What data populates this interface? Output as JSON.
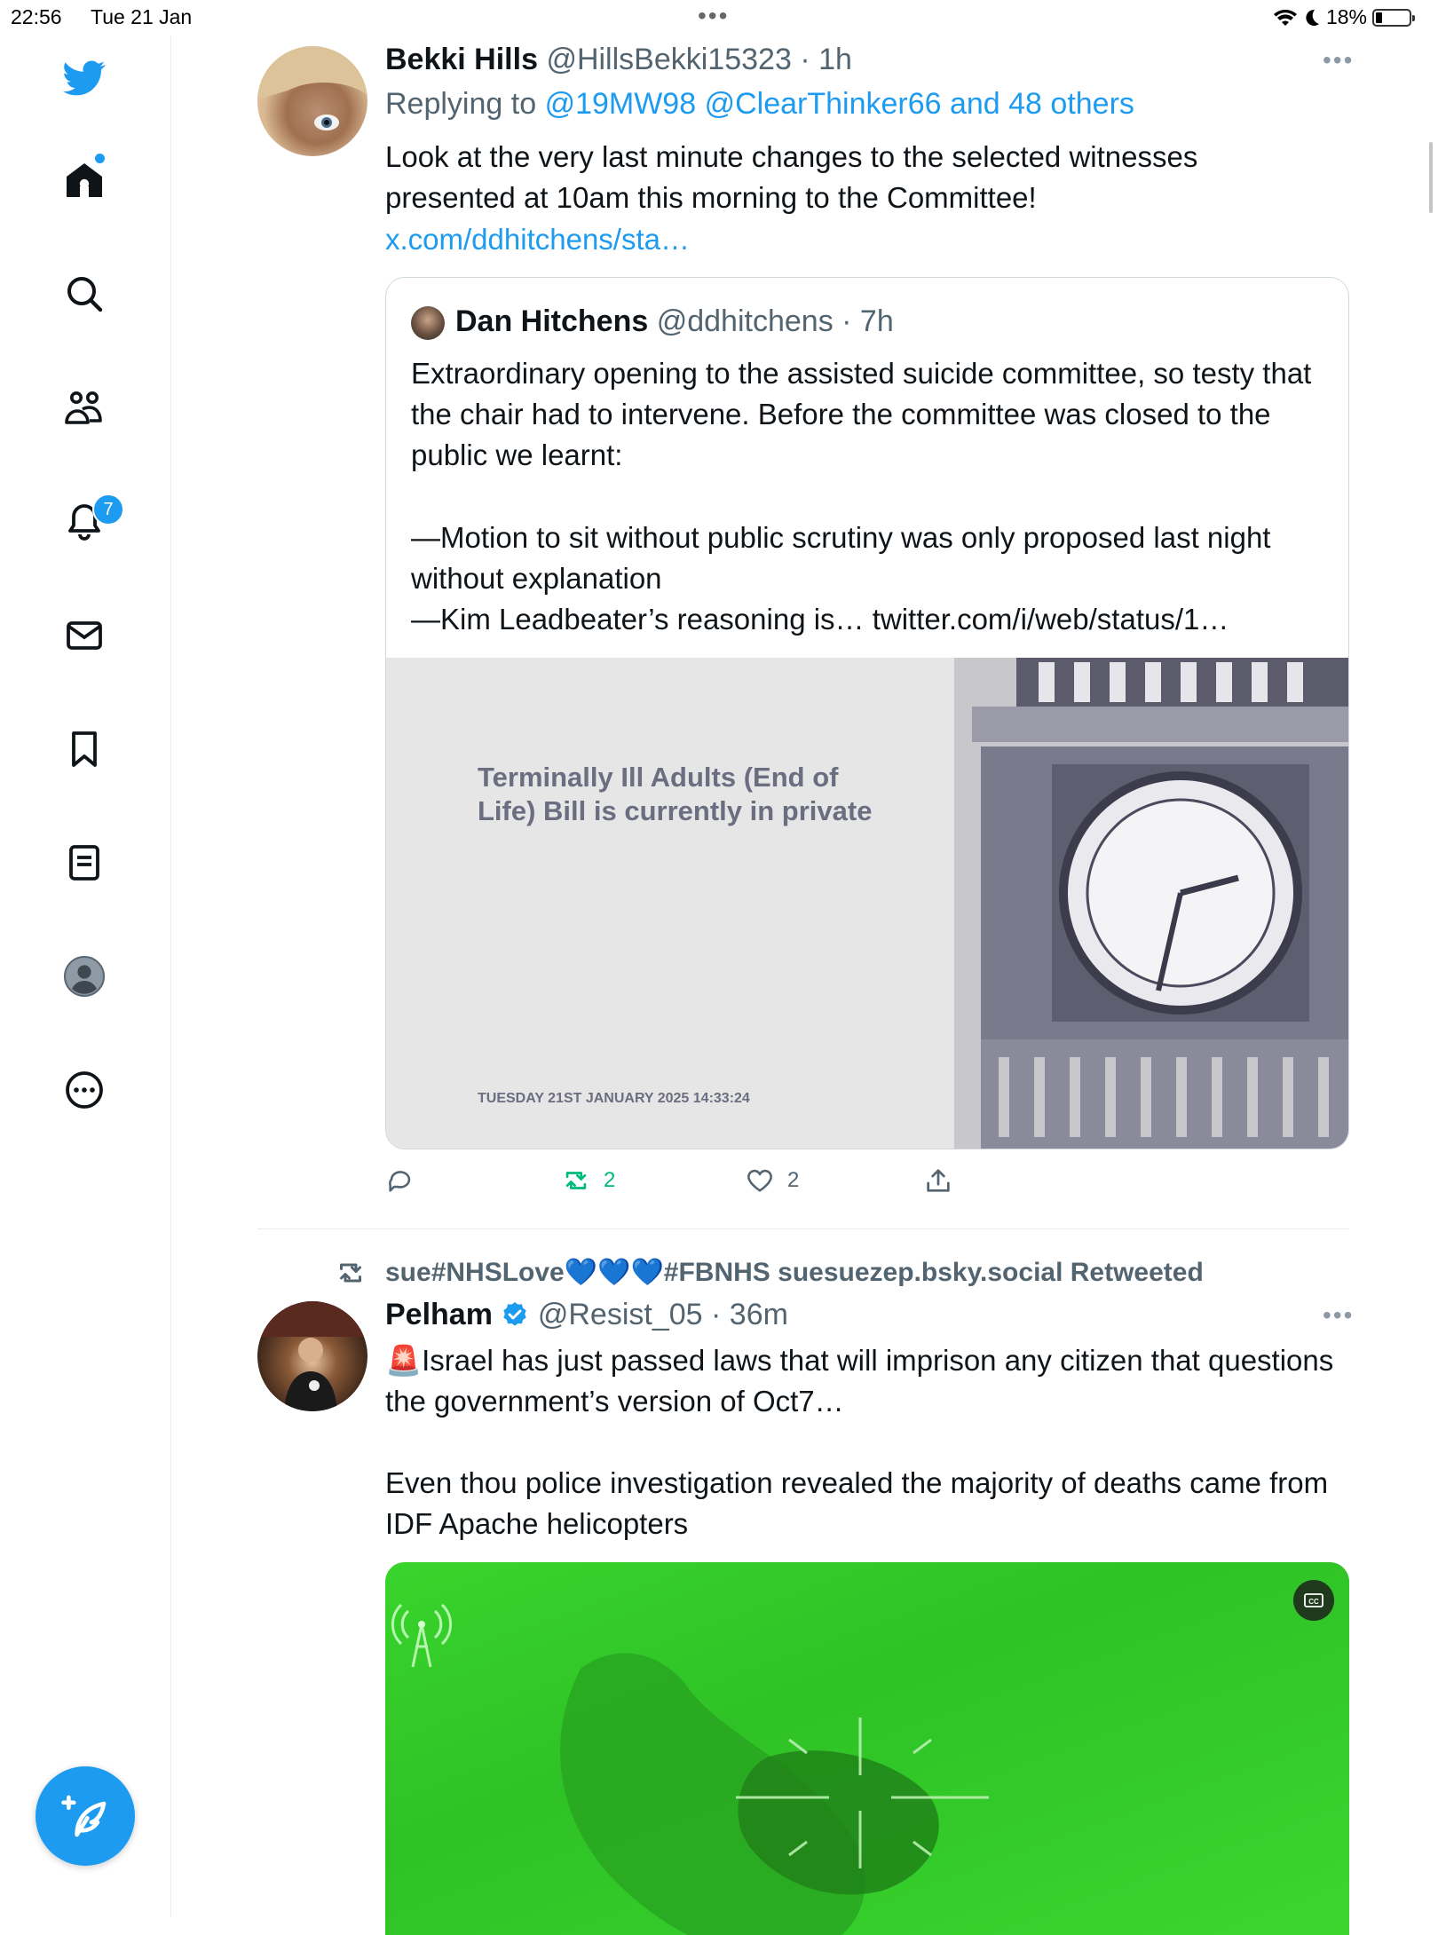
{
  "status_bar": {
    "time": "22:56",
    "date": "Tue 21 Jan",
    "battery_percent": "18%",
    "battery_level": 0.18
  },
  "sidebar": {
    "items": [
      {
        "name": "home"
      },
      {
        "name": "explore"
      },
      {
        "name": "communities"
      },
      {
        "name": "notifications",
        "badge": "7"
      },
      {
        "name": "messages"
      },
      {
        "name": "bookmarks"
      },
      {
        "name": "lists"
      },
      {
        "name": "profile"
      },
      {
        "name": "more"
      }
    ],
    "notification_count": "7"
  },
  "tweet1": {
    "name": "Bekki Hills",
    "handle": "@HillsBekki15323",
    "time": "· 1h",
    "replying_prefix": "Replying to",
    "replying_to": "@19MW98 @ClearThinker66 and 48 others",
    "text": "Look at the very last minute changes to the selected witnesses presented at 10am this morning to the Committee!",
    "link": "x.com/ddhitchens/sta…",
    "quote": {
      "name": "Dan Hitchens",
      "handle": "@ddhitchens",
      "time": "· 7h",
      "line1": "Extraordinary opening to the assisted suicide committee, so testy that the chair had to intervene. Before the committee was closed to the public we learnt:",
      "line2": "—Motion to sit without public scrutiny was only proposed last night without explanation",
      "line3": "—Kim Leadbeater’s reasoning is… twitter.com/i/web/status/1…",
      "image_caption": "Terminally Ill Adults (End of Life) Bill is currently in private",
      "image_stamp": "TUESDAY 21ST JANUARY 2025     14:33:24"
    },
    "actions": {
      "reply": "",
      "retweets": "2",
      "likes": "2"
    }
  },
  "tweet2": {
    "retweeted_by": "sue#NHSLove💙💙💙#FBNHS suesuezep.bsky.social Retweeted",
    "name": "Pelham",
    "handle": "@Resist_05",
    "time": "· 36m",
    "alert_emoji": "🚨",
    "text1": "Israel has just passed laws that will imprison any citizen that questions the government’s version of Oct7…",
    "text2": "Even thou police investigation revealed the majority of deaths came from IDF Apache helicopters"
  },
  "colors": {
    "accent": "#1d9bf0",
    "retweet_green": "#00ba7c",
    "text": "#0f1419",
    "muted": "#536471"
  }
}
